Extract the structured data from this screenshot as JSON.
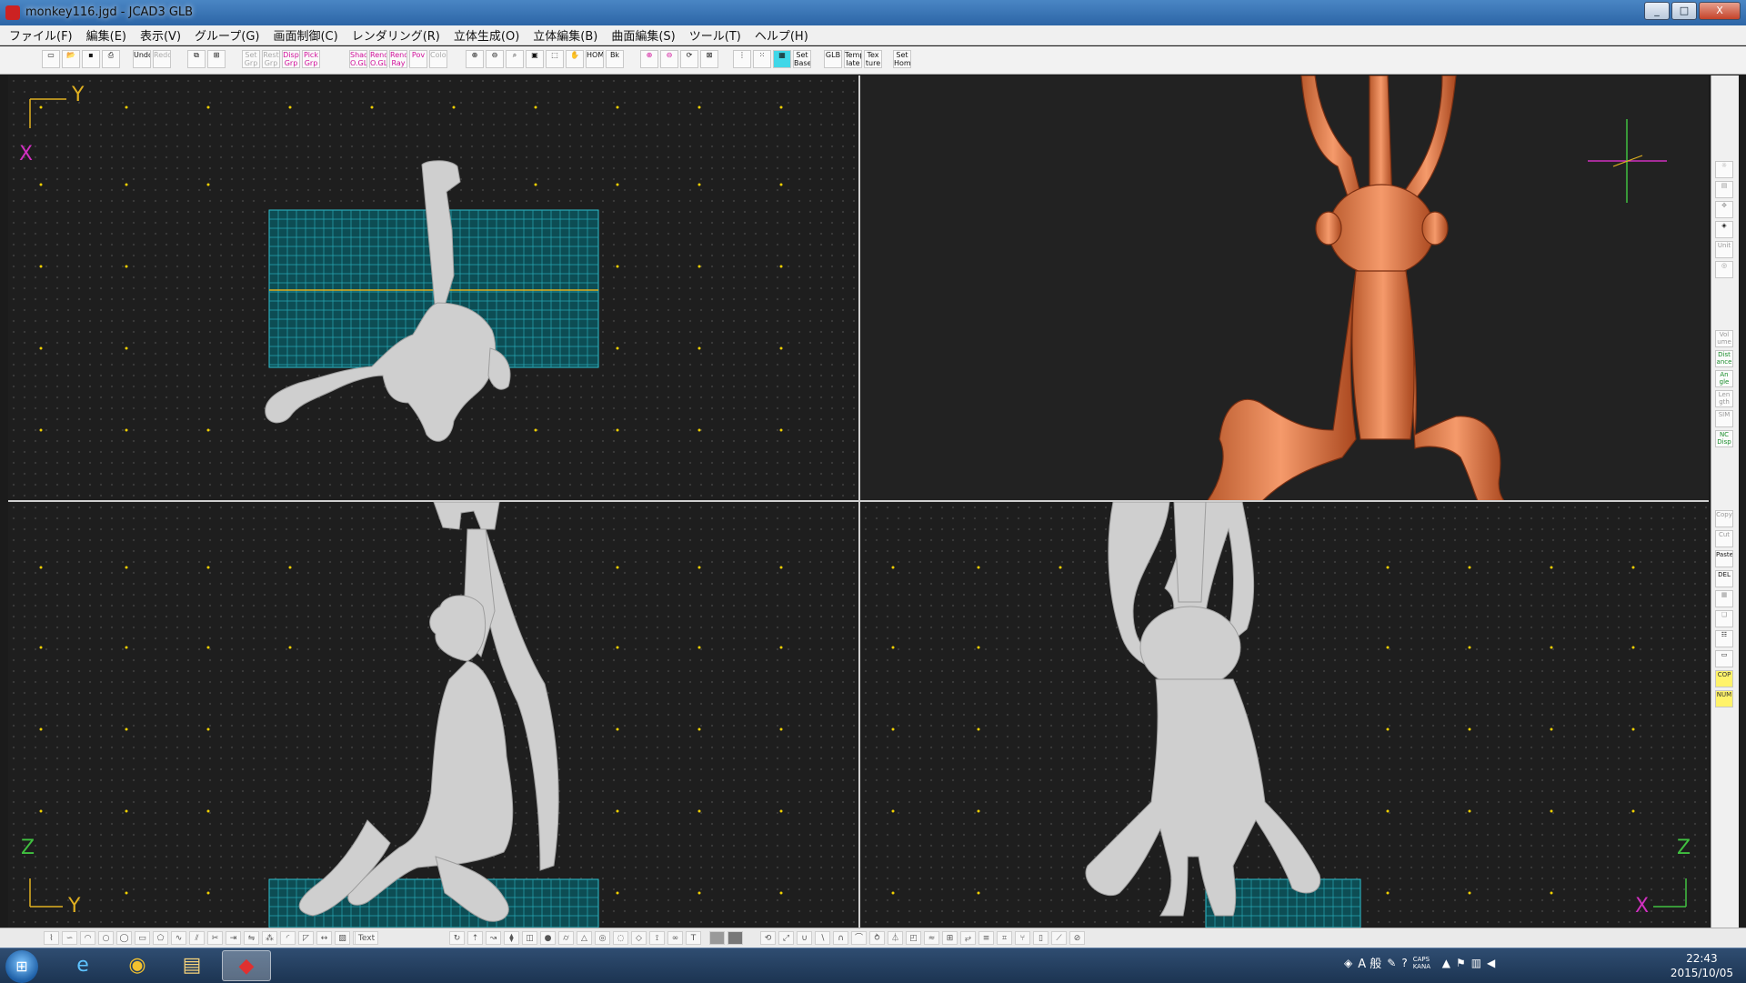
{
  "window": {
    "title": "monkey116.jgd - JCAD3 GLB",
    "controls": [
      "_",
      "□",
      "X"
    ]
  },
  "menu": [
    "ファイル(F)",
    "編集(E)",
    "表示(V)",
    "グループ(G)",
    "画面制御(C)",
    "レンダリング(R)",
    "立体生成(O)",
    "立体編集(B)",
    "曲面編集(S)",
    "ツール(T)",
    "ヘルプ(H)"
  ],
  "toolbar": {
    "set_grp": "Set Grp",
    "rest_grp": "Rest Grp",
    "disp_grp": "Disp Grp",
    "pick_grp": "Pick Grp",
    "shad_ogl": "Shad O.GL",
    "rend_ogl": "Rend O.GL",
    "rend_ray": "Rend Ray",
    "pov": "Pov",
    "color": "Color",
    "home": "HOME",
    "bk": "Bk",
    "set_base": "Set Base",
    "glb": "GLB",
    "template": "Temp late",
    "texture": "Tex ture",
    "set_home": "Set Home",
    "undo": "Undo",
    "redo": "Redo"
  },
  "viewports": {
    "top": {
      "axis_h": "Y",
      "axis_v": "X"
    },
    "side": {
      "axis_v": "Z",
      "axis_h": "Y"
    },
    "front": {
      "axis_v": "Z",
      "axis_h": "X"
    }
  },
  "right_palette": {
    "buttons": [
      "Vol ume",
      "Dist ance",
      "An gle",
      "Len gth",
      "SIM",
      "NC Disp",
      "Copy",
      "Cut",
      "Paste",
      "DEL",
      "COP",
      "NUM",
      "Unit"
    ]
  },
  "bottom_toolbar": {
    "text_label": "Text"
  },
  "taskbar": {
    "tray_text": "A 般",
    "caps_kana": "CAPS KANA",
    "time": "22:43",
    "date": "2015/10/05"
  }
}
